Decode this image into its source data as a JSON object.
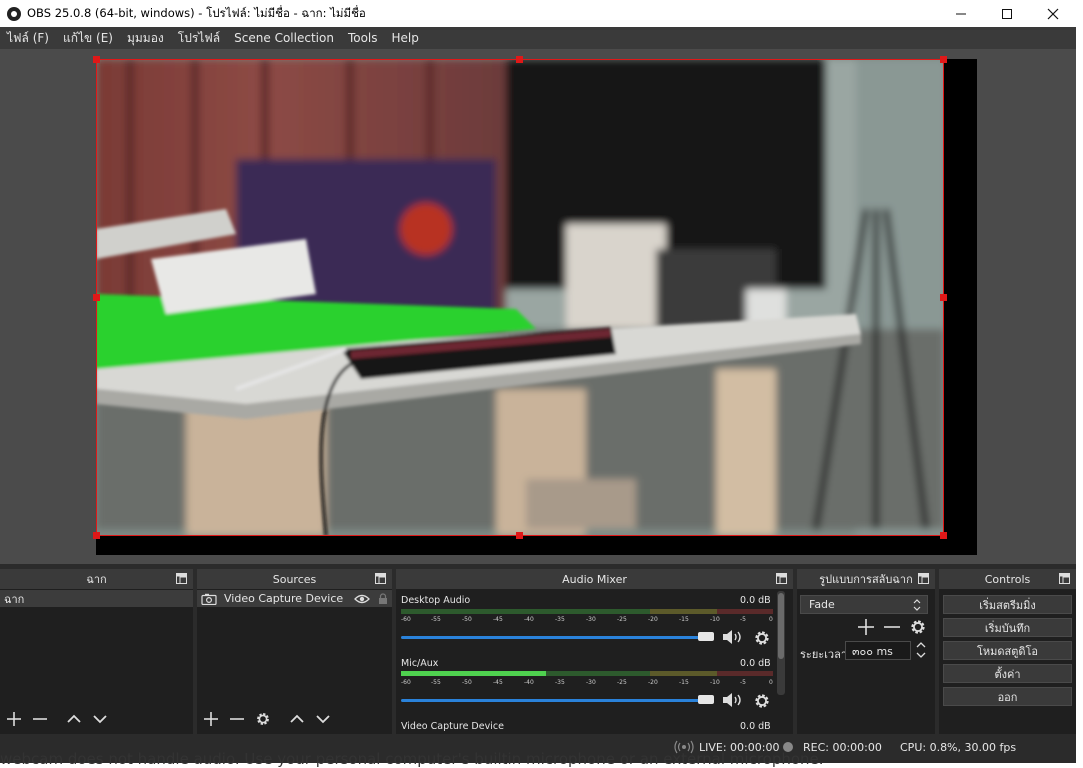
{
  "window": {
    "title": "OBS 25.0.8 (64-bit, windows) - โปรไฟล์: ไม่มีชื่อ - ฉาก: ไม่มีชื่อ"
  },
  "menu": [
    "ไฟล์ (F)",
    "แก้ไข (E)",
    "มุมมอง",
    "โปรไฟล์",
    "Scene Collection",
    "Tools",
    "Help"
  ],
  "panels": {
    "scenes": {
      "title": "ฉาก",
      "items": [
        "ฉาก"
      ]
    },
    "sources": {
      "title": "Sources",
      "items": [
        "Video Capture Device"
      ]
    },
    "mixer": {
      "title": "Audio Mixer",
      "channels": [
        {
          "name": "Desktop Audio",
          "db": "0.0 dB",
          "level": 0
        },
        {
          "name": "Mic/Aux",
          "db": "0.0 dB",
          "level": 0.39
        },
        {
          "name": "Video Capture Device",
          "db": "0.0 dB",
          "level": 0
        }
      ],
      "ticks": [
        "-60",
        "-55",
        "-50",
        "-45",
        "-40",
        "-35",
        "-30",
        "-25",
        "-20",
        "-15",
        "-10",
        "-5",
        "0"
      ]
    },
    "transitions": {
      "title": "รูปแบบการสลับฉาก",
      "type": "Fade",
      "duration_label": "ระยะเวลา",
      "duration_value": "๓๐๐ ms"
    },
    "controls": {
      "title": "Controls",
      "buttons": [
        "เริ่มสตรีมมิ่ง",
        "เริ่มบันทึก",
        "โหมดสตูดิโอ",
        "ตั้งค่า",
        "ออก"
      ]
    }
  },
  "status": {
    "live": "LIVE: 00:00:00",
    "rec": "REC: 00:00:00",
    "cpu": "CPU: 0.8%, 30.00 fps"
  },
  "background_text": "webcam does not handle audio. Use your personal computer's builtin microphone or an external microphone."
}
